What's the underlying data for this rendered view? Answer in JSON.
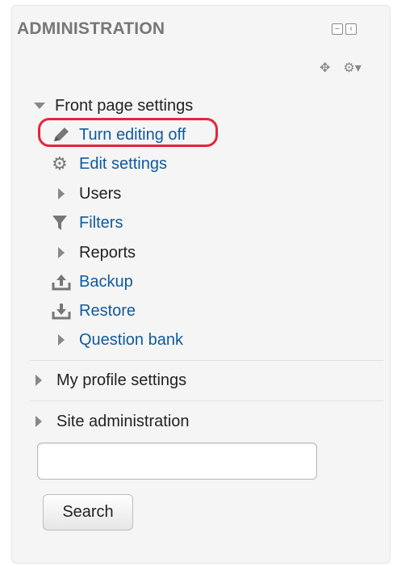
{
  "block": {
    "title": "ADMINISTRATION",
    "dock_icons": [
      "minimize-icon",
      "dock-icon"
    ],
    "control_icons": [
      "move-icon",
      "gear-menu-icon"
    ]
  },
  "tree": {
    "front_page": {
      "label": "Front page settings",
      "items": {
        "turn_editing_off": "Turn editing off",
        "edit_settings": "Edit settings",
        "users": "Users",
        "filters": "Filters",
        "reports": "Reports",
        "backup": "Backup",
        "restore": "Restore",
        "question_bank": "Question bank"
      }
    },
    "my_profile": "My profile settings",
    "site_admin": "Site administration"
  },
  "search": {
    "value": "",
    "placeholder": "",
    "button_label": "Search"
  },
  "colors": {
    "link": "#0f5a9c",
    "highlight": "#e3263a",
    "title": "#777777"
  }
}
